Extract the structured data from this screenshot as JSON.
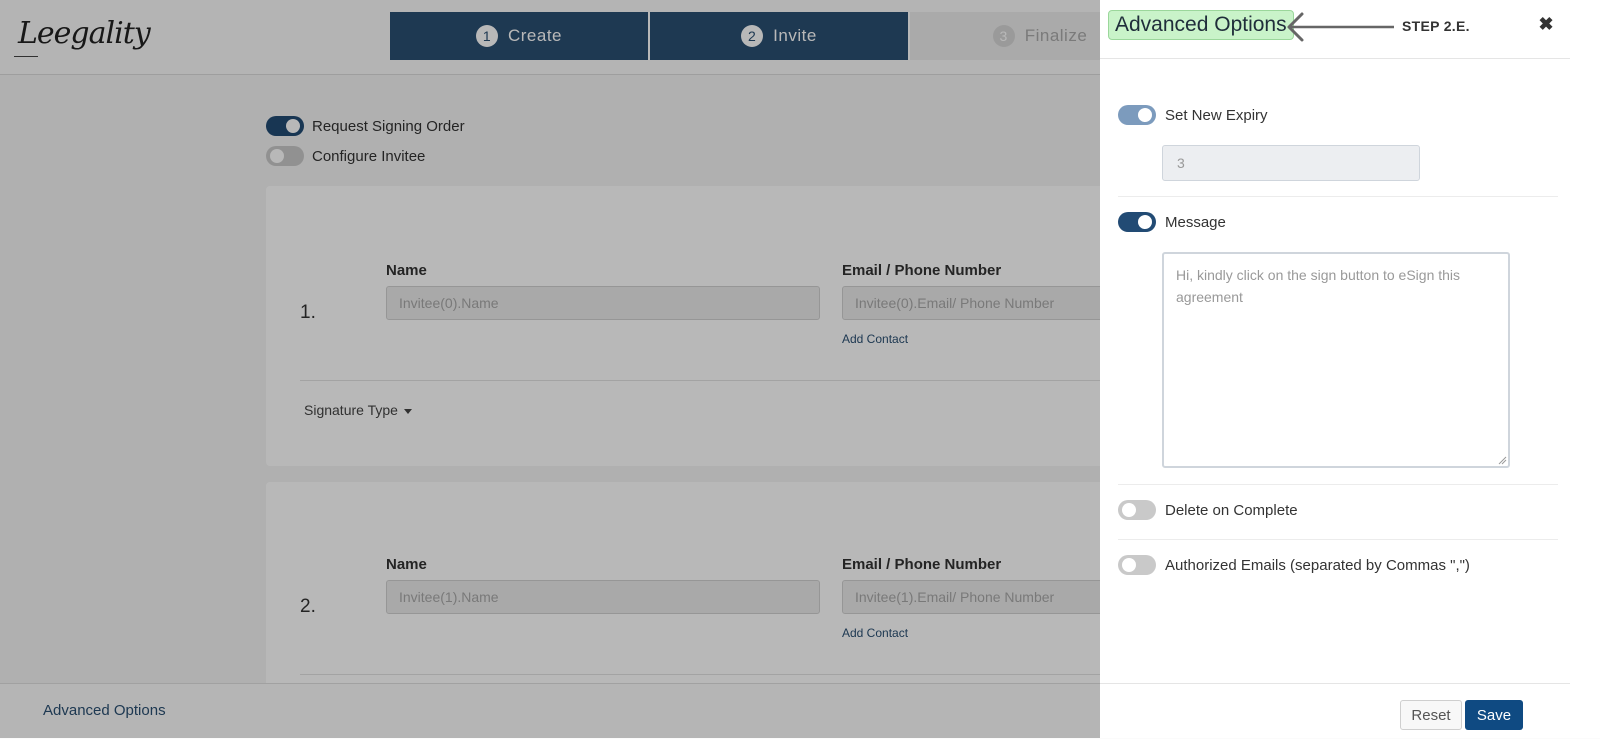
{
  "logo": {
    "text": "Leegality"
  },
  "steps": [
    {
      "num": "1",
      "label": "Create"
    },
    {
      "num": "2",
      "label": "Invite"
    },
    {
      "num": "3",
      "label": "Finalize"
    }
  ],
  "background": {
    "request_signing_order": "Request Signing Order",
    "configure_invitee": "Configure Invitee",
    "invitees": [
      {
        "num": "1.",
        "name_label": "Name",
        "name_placeholder": "Invitee(0).Name",
        "email_label": "Email / Phone Number",
        "email_placeholder": "Invitee(0).Email/ Phone Number",
        "add_contact": "Add Contact",
        "signature_type": "Signature Type"
      },
      {
        "num": "2.",
        "name_label": "Name",
        "name_placeholder": "Invitee(1).Name",
        "email_label": "Email / Phone Number",
        "email_placeholder": "Invitee(1).Email/ Phone Number",
        "add_contact": "Add Contact"
      }
    ],
    "advanced_options_link": "Advanced Options"
  },
  "panel": {
    "title": "Advanced Options",
    "step_tag": "STEP 2.E.",
    "set_new_expiry": {
      "label": "Set New Expiry",
      "value": "3",
      "enabled": true
    },
    "message": {
      "label": "Message",
      "value": "Hi, kindly click on the sign button to eSign this agreement",
      "enabled": true
    },
    "delete_on_complete": {
      "label": "Delete on Complete",
      "enabled": false
    },
    "authorized_emails": {
      "label": "Authorized Emails (separated by Commas \",\")",
      "enabled": false
    },
    "reset_label": "Reset",
    "save_label": "Save"
  },
  "colors": {
    "primary": "#2a4f72",
    "save": "#0f4a82",
    "highlight": "#c9f3c9"
  }
}
